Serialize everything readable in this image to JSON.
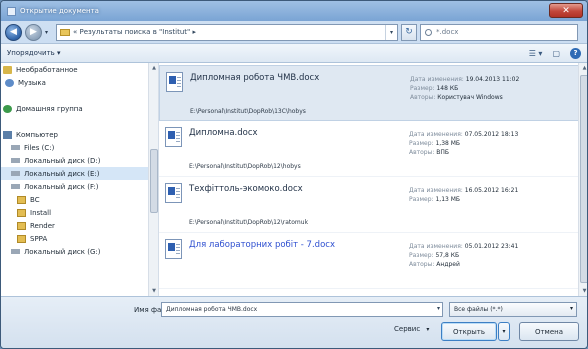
{
  "window": {
    "title": "Открытие документа",
    "close_glyph": "✕"
  },
  "nav": {
    "back_glyph": "◀",
    "forward_glyph": "▶",
    "address": "« Результаты поиска в \"Institut\" ▸",
    "refresh_glyph": "↻",
    "search_value": "*.docx"
  },
  "toolbar": {
    "organize_label": "Упорядочить ▾",
    "view_glyph": "☰ ▾",
    "pane_glyph": "▢",
    "help_glyph": "?"
  },
  "sidebar": {
    "items": [
      {
        "label": "Необработанное",
        "icon": "favorites-icon"
      },
      {
        "label": "Музыка",
        "icon": "music-icon"
      },
      {
        "label": "",
        "icon": ""
      },
      {
        "label": "Домашняя группа",
        "icon": "homegroup-icon"
      },
      {
        "label": "",
        "icon": ""
      },
      {
        "label": "Компьютер",
        "icon": "computer-icon"
      },
      {
        "label": "Files (C:)",
        "icon": "disk-icon"
      },
      {
        "label": "Локальный диск (D:)",
        "icon": "disk-icon"
      },
      {
        "label": "Локальный диск (E:)",
        "icon": "disk-icon",
        "selected": true
      },
      {
        "label": "Локальный диск (F:)",
        "icon": "disk-icon"
      },
      {
        "label": "ВС",
        "icon": "folder-icon"
      },
      {
        "label": "Install",
        "icon": "folder-icon"
      },
      {
        "label": "Render",
        "icon": "folder-icon"
      },
      {
        "label": "SPPA",
        "icon": "folder-icon"
      },
      {
        "label": "Локальный диск (G:)",
        "icon": "disk-icon"
      }
    ]
  },
  "files": [
    {
      "name": "Дипломная робота ЧМВ.docx",
      "path": "E:\\Personal\\Institut\\DopRob\\13C\\hobys",
      "date_label": "Дата изменения:",
      "date_value": "19.04.2013 11:02",
      "size_label": "Размер:",
      "size_value": "148 КБ",
      "author_label": "Авторы:",
      "author_value": "Користувач Windows",
      "selected": true,
      "link": false
    },
    {
      "name": "Дипломна.docx",
      "path": "E:\\Personal\\Institut\\DopRob\\12\\hobys",
      "date_label": "Дата изменения:",
      "date_value": "07.05.2012 18:13",
      "size_label": "Размер:",
      "size_value": "1,38 МБ",
      "author_label": "Авторы:",
      "author_value": "ВПБ",
      "selected": false,
      "link": false
    },
    {
      "name": "Техфіттоль-экомоко.docx",
      "path": "E:\\Personal\\Institut\\DopRob\\12\\ratomuk",
      "date_label": "Дата изменения:",
      "date_value": "16.05.2012 16:21",
      "size_label": "Размер:",
      "size_value": "1,13 МБ",
      "author_label": "",
      "author_value": "",
      "selected": false,
      "link": false
    },
    {
      "name": "Для лабораторних робіт - 7.docx",
      "path": "",
      "date_label": "Дата изменения:",
      "date_value": "05.01.2012 23:41",
      "size_label": "Размер:",
      "size_value": "57,8 КБ",
      "author_label": "Авторы:",
      "author_value": "Андрей",
      "selected": false,
      "link": true
    }
  ],
  "bottom": {
    "filename_label": "Имя файла:",
    "filename_value": "Дипломная робота ЧМВ.docx",
    "filter_value": "Все файлы (*.*)",
    "service_label": "Сервис",
    "open_label": "Открыть",
    "cancel_label": "Отмена",
    "dropdown_glyph": "▾"
  }
}
